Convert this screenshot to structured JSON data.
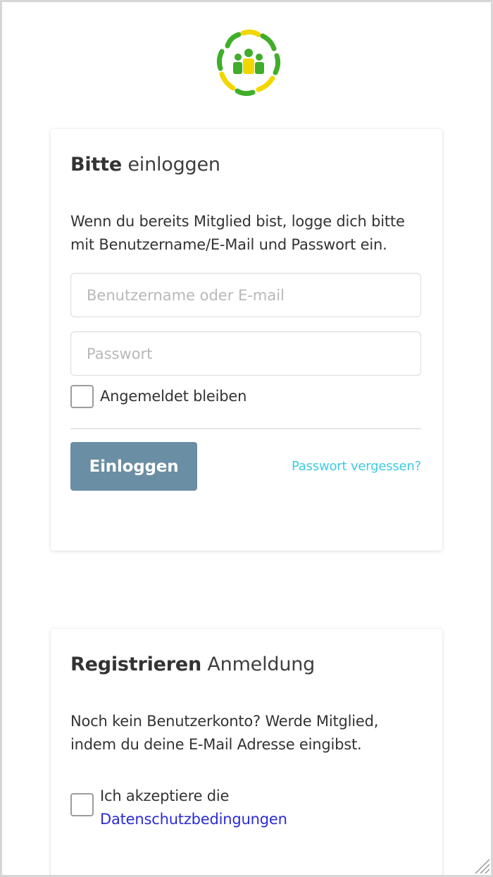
{
  "logo": {
    "icon": "community-logo-icon",
    "colors": {
      "green": "#3fae29",
      "yellow": "#f2d600"
    }
  },
  "login": {
    "title_bold": "Bitte",
    "title_rest": " einloggen",
    "intro": "Wenn du bereits Mitglied bist, logge dich bitte mit Benutzername/E-Mail und Passwort ein.",
    "username_placeholder": "Benutzername oder E-mail",
    "password_placeholder": "Passwort",
    "remember_label": "Angemeldet bleiben",
    "submit_label": "Einloggen",
    "forgot_label": "Passwort vergessen?"
  },
  "register": {
    "title_bold": "Registrieren",
    "title_rest": " Anmeldung",
    "intro": "Noch kein Benutzerkonto? Werde Mitglied, indem du deine E-Mail Adresse eingibst.",
    "accept_prefix": "Ich akzeptiere die",
    "privacy_link": "Datenschutzbedingungen"
  },
  "colors": {
    "button": "#6a8ea3",
    "link_forgot": "#3dcbe0",
    "link_privacy": "#2b2bd6"
  }
}
